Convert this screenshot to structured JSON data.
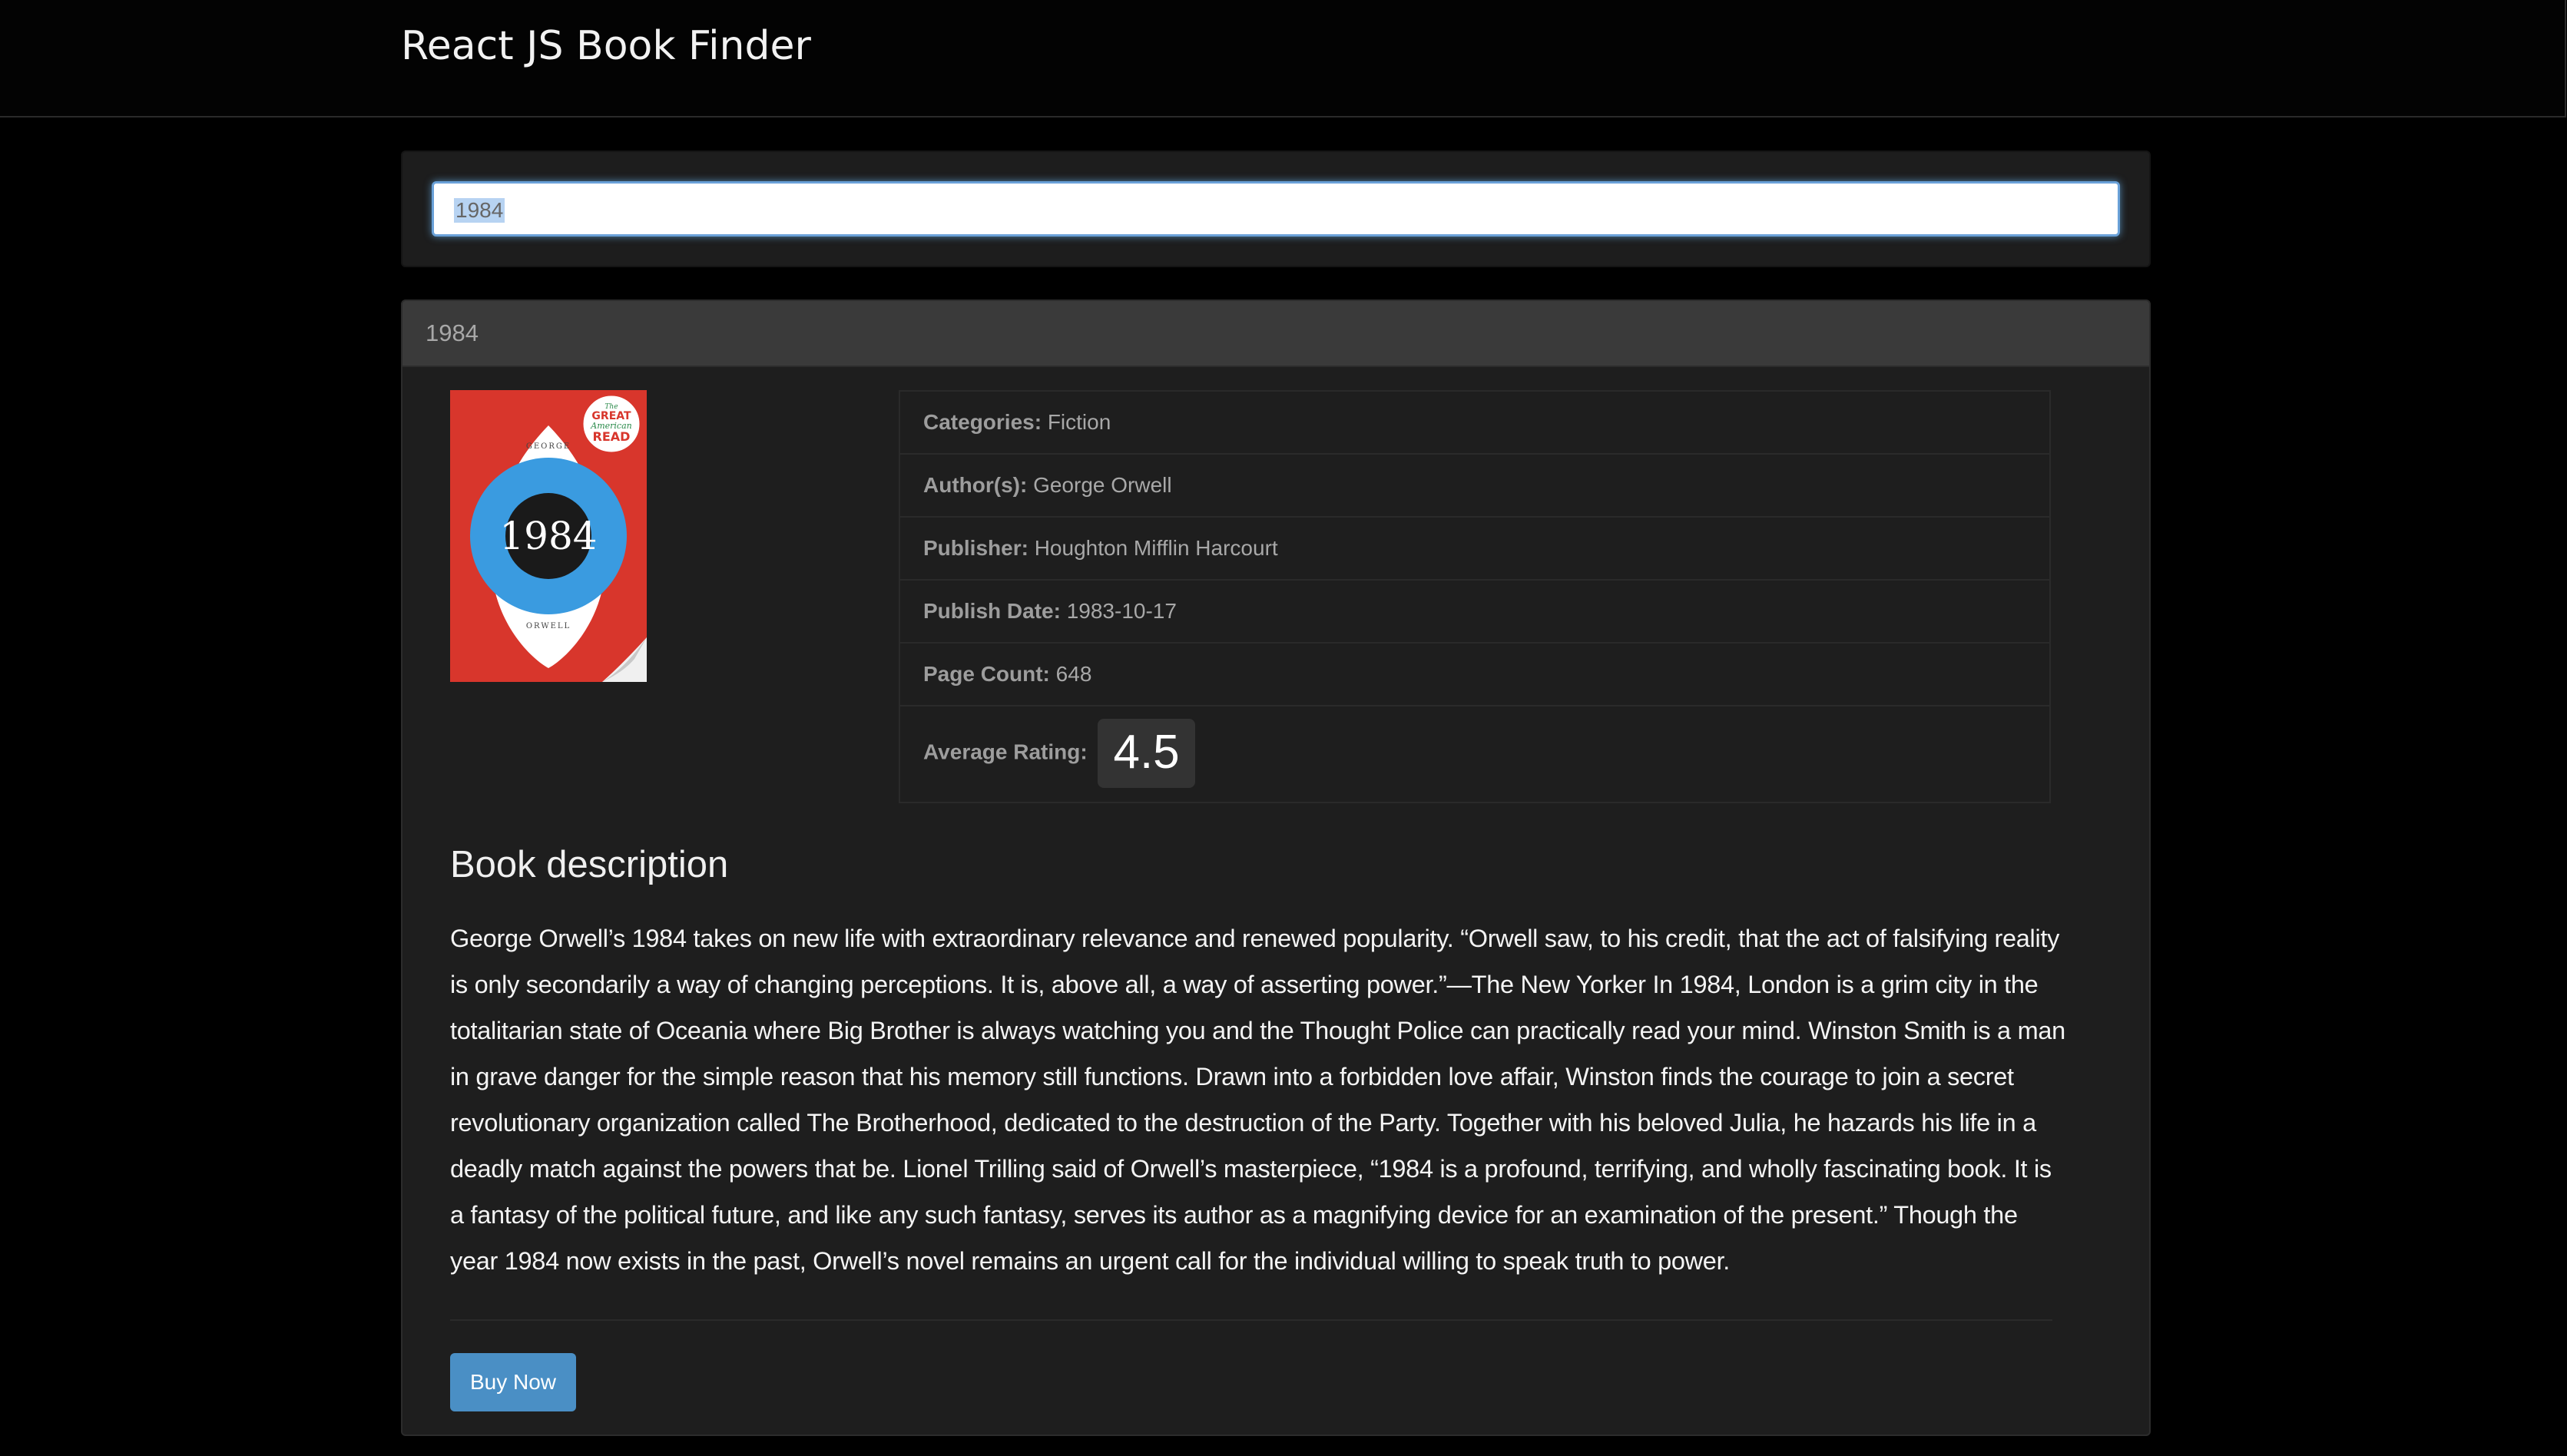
{
  "header": {
    "brand": "React JS Book Finder"
  },
  "search": {
    "value": "1984",
    "placeholder": ""
  },
  "book": {
    "title": "1984",
    "cover": {
      "author_top": "GEORGE",
      "title": "1984",
      "author_bottom": "ORWELL",
      "badge_line1": "The",
      "badge_line2": "GREAT",
      "badge_line3": "American",
      "badge_line4": "READ",
      "colors": {
        "background": "#d8362c",
        "eye": "#ffffff",
        "iris": "#3a9be0",
        "pupil": "#1a1a1a"
      }
    },
    "details": {
      "categories_label": "Categories:",
      "categories_value": "Fiction",
      "authors_label": "Author(s):",
      "authors_value": "George Orwell",
      "publisher_label": "Publisher:",
      "publisher_value": "Houghton Mifflin Harcourt",
      "publish_date_label": "Publish Date:",
      "publish_date_value": "1983-10-17",
      "page_count_label": "Page Count:",
      "page_count_value": "648",
      "rating_label": "Average Rating:",
      "rating_value": "4.5"
    },
    "description_heading": "Book description",
    "description": "George Orwell’s 1984 takes on new life with extraordinary relevance and renewed popularity. “Orwell saw, to his credit, that the act of falsifying reality is only secondarily a way of changing perceptions. It is, above all, a way of asserting power.”—The New Yorker In 1984, London is a grim city in the totalitarian state of Oceania where Big Brother is always watching you and the Thought Police can practically read your mind. Winston Smith is a man in grave danger for the simple reason that his memory still functions. Drawn into a forbidden love affair, Winston finds the courage to join a secret revolutionary organization called The Brotherhood, dedicated to the destruction of the Party. Together with his beloved Julia, he hazards his life in a deadly match against the powers that be. Lionel Trilling said of Orwell’s masterpiece, “1984 is a profound, terrifying, and wholly fascinating book. It is a fantasy of the political future, and like any such fantasy, serves its author as a magnifying device for an examination of the present.” Though the year 1984 now exists in the past, Orwell’s novel remains an urgent call for the individual willing to speak truth to power.",
    "buy_label": "Buy Now"
  },
  "colors": {
    "page_bg": "#000000",
    "panel_bg": "#1e1e1e",
    "panel_heading_bg": "#3a3a3a",
    "button_bg": "#4a8fc5",
    "focus_border": "#6aa1d8"
  }
}
